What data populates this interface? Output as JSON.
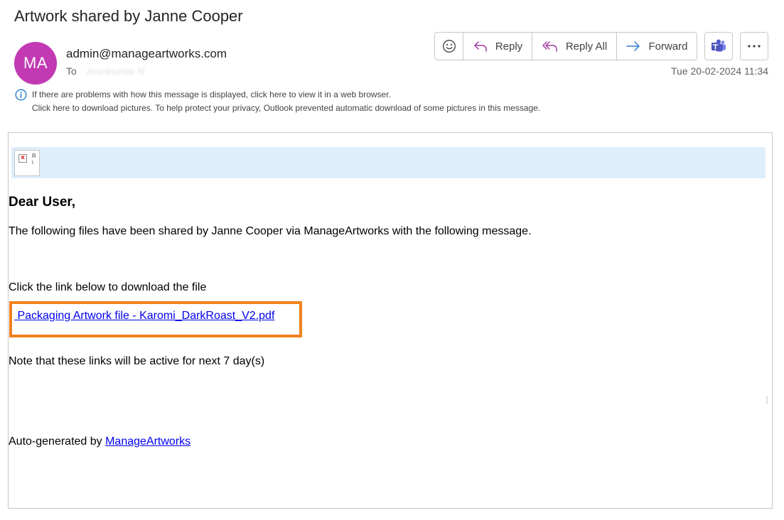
{
  "subject": "Artwork shared by Janne Cooper",
  "sender": {
    "initials": "MA",
    "email": "admin@manageartworks.com",
    "avatar_color": "#c239b3"
  },
  "to": {
    "label": "To",
    "recipient": "Arunkumar R"
  },
  "timestamp": "Tue 20-02-2024 11:34",
  "toolbar": {
    "emoji_icon": "smiley-icon",
    "reply_label": "Reply",
    "reply_all_label": "Reply All",
    "forward_label": "Forward",
    "teams_icon": "teams-icon",
    "more_icon": "more-icon"
  },
  "infobar": {
    "line1": "If there are problems with how this message is displayed, click here to view it in a web browser.",
    "line2": "Click here to download pictures. To help protect your privacy, Outlook prevented automatic download of some pictures in this message."
  },
  "body": {
    "banner_color": "#deeefb",
    "broken_image_alt": "R\ni",
    "salutation": "Dear User,",
    "intro": "The following files have been shared by Janne Cooper via ManageArtworks with the following message.",
    "instruction": "Click the link below to download the file",
    "file_link": " Packaging Artwork file - Karomi_DarkRoast_V2.pdf",
    "note": "Note that these links will be active for next 7 day(s)",
    "footer_prefix": "Auto-generated by ",
    "footer_link": "ManageArtworks",
    "highlight_color": "#f2811d"
  }
}
